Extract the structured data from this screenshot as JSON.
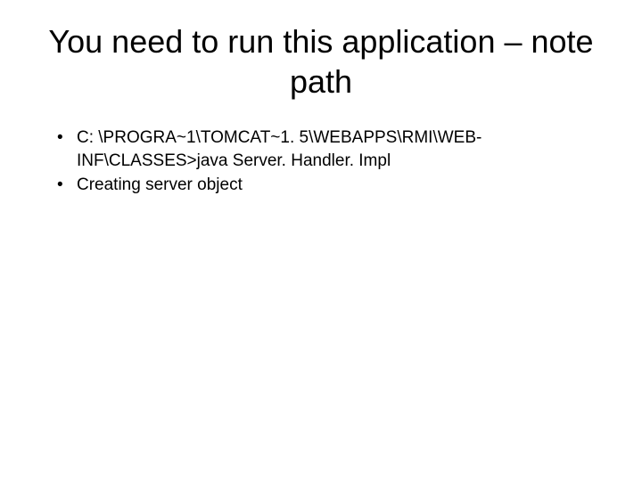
{
  "slide": {
    "title": "You need to run this application – note path",
    "bullets": [
      "C: \\PROGRA~1\\TOMCAT~1. 5\\WEBAPPS\\RMI\\WEB-INF\\CLASSES>java Server. Handler. Impl",
      "Creating server object"
    ]
  }
}
